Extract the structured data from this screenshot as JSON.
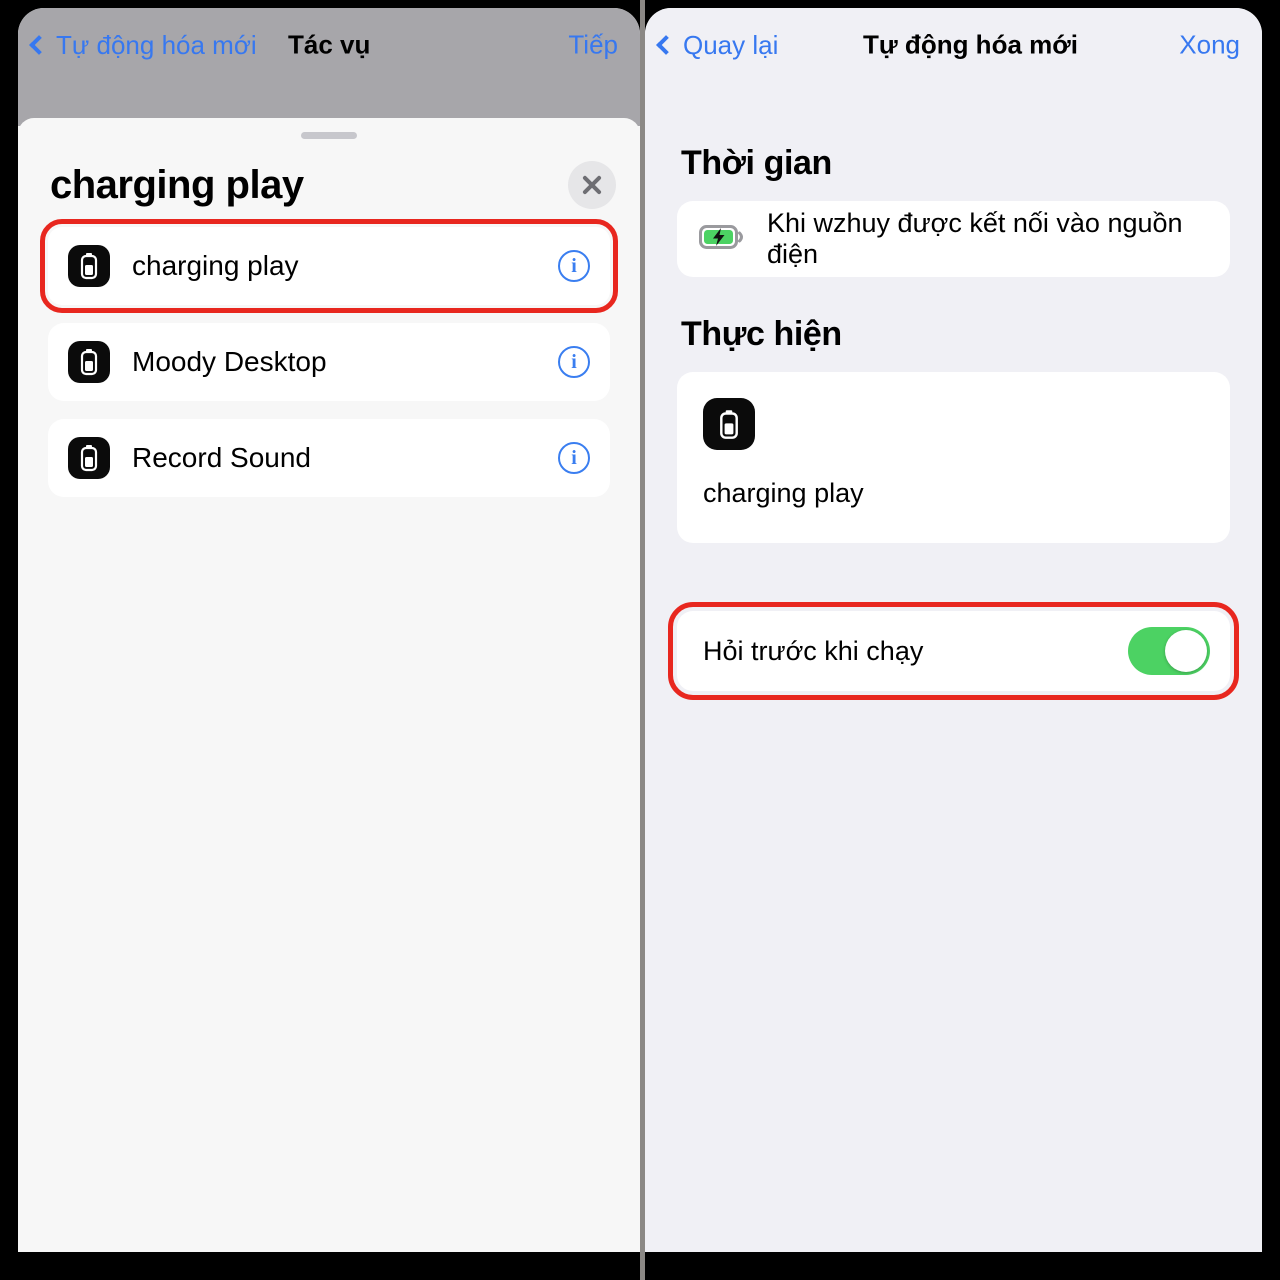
{
  "left_panel": {
    "nav": {
      "back_label": "Tự động hóa mới",
      "title": "Tác vụ",
      "next_label": "Tiếp"
    },
    "sheet": {
      "title": "charging play",
      "close_icon": "close-icon",
      "items": [
        {
          "label": "charging play",
          "icon": "battery-app-icon",
          "info_icon": "info-circle-icon",
          "highlighted": true
        },
        {
          "label": "Moody Desktop",
          "icon": "battery-app-icon",
          "info_icon": "info-circle-icon",
          "highlighted": false
        },
        {
          "label": "Record Sound",
          "icon": "battery-app-icon",
          "info_icon": "info-circle-icon",
          "highlighted": false
        }
      ]
    }
  },
  "right_panel": {
    "nav": {
      "back_label": "Quay lại",
      "title": "Tự động hóa mới",
      "done_label": "Xong"
    },
    "time_section": {
      "heading": "Thời gian",
      "trigger_label": "Khi wzhuy được kết nối vào nguồn điện",
      "trigger_icon": "battery-charging-icon"
    },
    "action_section": {
      "heading": "Thực hiện",
      "action_label": "charging play",
      "action_icon": "battery-app-icon"
    },
    "ask_before_running": {
      "label": "Hỏi trước khi chạy",
      "toggle_state": "on",
      "highlighted": true
    }
  },
  "colors": {
    "accent_blue": "#3778f0",
    "highlight_red": "#e8271f",
    "toggle_green": "#4cd263",
    "left_bg": "#f7f7f7",
    "right_bg": "#f0f0f5",
    "navbar_dim": "#a7a6aa"
  }
}
